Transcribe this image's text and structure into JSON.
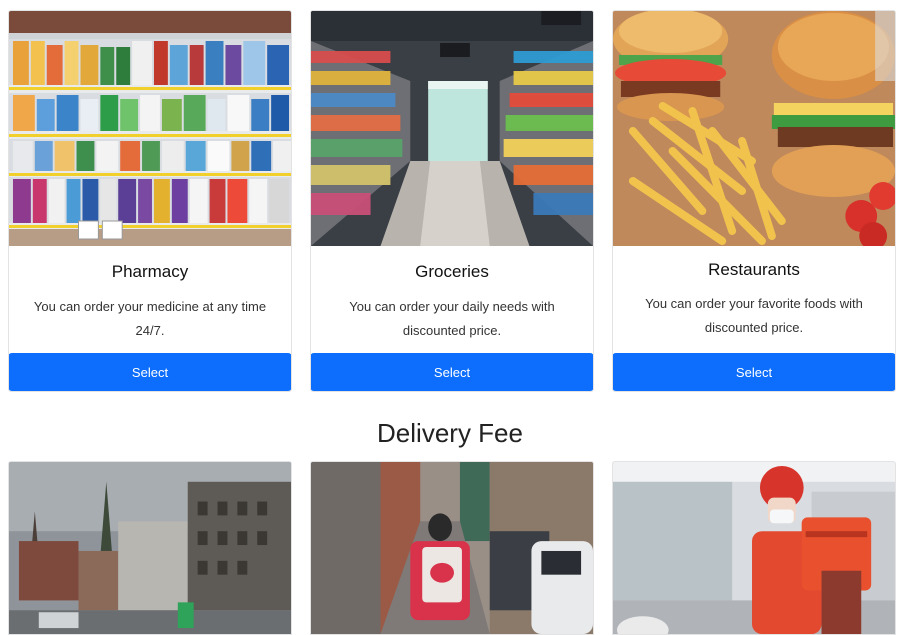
{
  "services": [
    {
      "title": "Pharmacy",
      "description": "You can order your medicine at any time 24/7.",
      "button_label": "Select"
    },
    {
      "title": "Groceries",
      "description": "You can order your daily needs with discounted price.",
      "button_label": "Select"
    },
    {
      "title": "Restaurants",
      "description": "You can order your favorite foods with discounted price.",
      "button_label": "Select"
    }
  ],
  "delivery": {
    "heading": "Delivery Fee"
  },
  "colors": {
    "primary": "#0d6efd"
  }
}
